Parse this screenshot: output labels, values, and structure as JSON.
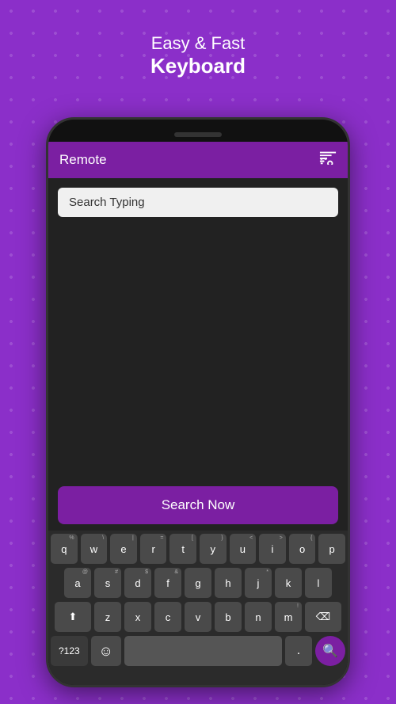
{
  "background": {
    "color": "#8b2fc9"
  },
  "header": {
    "subtitle": "Easy & Fast",
    "title": "Keyboard"
  },
  "app": {
    "title": "Remote",
    "cast_icon": "⊡",
    "search_placeholder": "Search Typing",
    "search_button_label": "Search Now"
  },
  "keyboard": {
    "row1": [
      {
        "char": "q",
        "sup": "%"
      },
      {
        "char": "w",
        "sup": "\\"
      },
      {
        "char": "e",
        "sup": "|"
      },
      {
        "char": "r",
        "sup": "="
      },
      {
        "char": "t",
        "sup": "["
      },
      {
        "char": "y",
        "sup": "}"
      },
      {
        "char": "u",
        "sup": "<"
      },
      {
        "char": "i",
        "sup": ">"
      },
      {
        "char": "o",
        "sup": "{"
      },
      {
        "char": "p",
        "sup": ""
      }
    ],
    "row2": [
      {
        "char": "a",
        "sup": "@"
      },
      {
        "char": "s",
        "sup": "#"
      },
      {
        "char": "d",
        "sup": "$"
      },
      {
        "char": "f",
        "sup": "&"
      },
      {
        "char": "g",
        "sup": ""
      },
      {
        "char": "h",
        "sup": ""
      },
      {
        "char": "j",
        "sup": "*"
      },
      {
        "char": "k",
        "sup": ""
      },
      {
        "char": "l",
        "sup": ""
      }
    ],
    "row3": [
      {
        "char": "z",
        "sup": ""
      },
      {
        "char": "x",
        "sup": ""
      },
      {
        "char": "c",
        "sup": ""
      },
      {
        "char": "v",
        "sup": ""
      },
      {
        "char": "b",
        "sup": ""
      },
      {
        "char": "n",
        "sup": ""
      },
      {
        "char": "m",
        "sup": "!"
      }
    ],
    "bottom": {
      "numbers_label": "?123",
      "period_label": ".",
      "search_icon": "🔍"
    }
  }
}
